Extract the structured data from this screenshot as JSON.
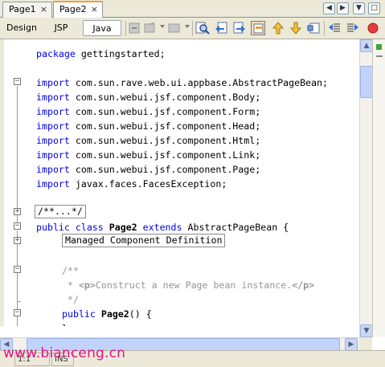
{
  "tabs": [
    {
      "label": "Page1",
      "close": "×",
      "active": false
    },
    {
      "label": "Page2",
      "close": "×",
      "active": true
    }
  ],
  "view_buttons": [
    "Design",
    "JSP",
    "Java"
  ],
  "active_view": "Java",
  "toolbar_icons": [
    "select-field-icon",
    "select-method-icon",
    "select-property-icon",
    "find-icon",
    "find-previous-icon",
    "find-next-icon",
    "toggle-highlight-icon",
    "previous-bookmark-icon",
    "next-bookmark-icon",
    "toggle-bookmark-icon",
    "shift-left-icon",
    "shift-right-icon",
    "stop-record-macro-icon"
  ],
  "code": {
    "package_line": {
      "kw": "package",
      "rest": " gettingstarted;"
    },
    "import_keyword": "import",
    "imports": [
      " com.sun.rave.web.ui.appbase.AbstractPageBean;",
      " com.sun.webui.jsf.component.Body;",
      " com.sun.webui.jsf.component.Form;",
      " com.sun.webui.jsf.component.Head;",
      " com.sun.webui.jsf.component.Html;",
      " com.sun.webui.jsf.component.Link;",
      " com.sun.webui.jsf.component.Page;",
      " javax.faces.FacesException;"
    ],
    "folded_comment": "/**...*/",
    "class_line": {
      "kw1": "public class",
      "name": "Page2",
      "kw2": "extends",
      "rest": " AbstractPageBean {"
    },
    "folded_region": "Managed Component Definition",
    "javadoc": {
      "open": "/**",
      "star": " * ",
      "tag_open": "<p>",
      "text": "Construct a new Page bean instance.",
      "tag_close": "</p>",
      "close": " */"
    },
    "constructor_line": {
      "kw": "public",
      "name": "Page2",
      "rest": "() {"
    },
    "closing_brace": "}"
  },
  "status": {
    "position": "1:1",
    "mode": "INS"
  },
  "watermark": "www.bianceng.cn",
  "colors": {
    "keyword": "#0000e6",
    "comment": "#969696",
    "accent_tab": "#f0a030",
    "watermark": "#e0138c",
    "mark_ok": "#38a838"
  }
}
